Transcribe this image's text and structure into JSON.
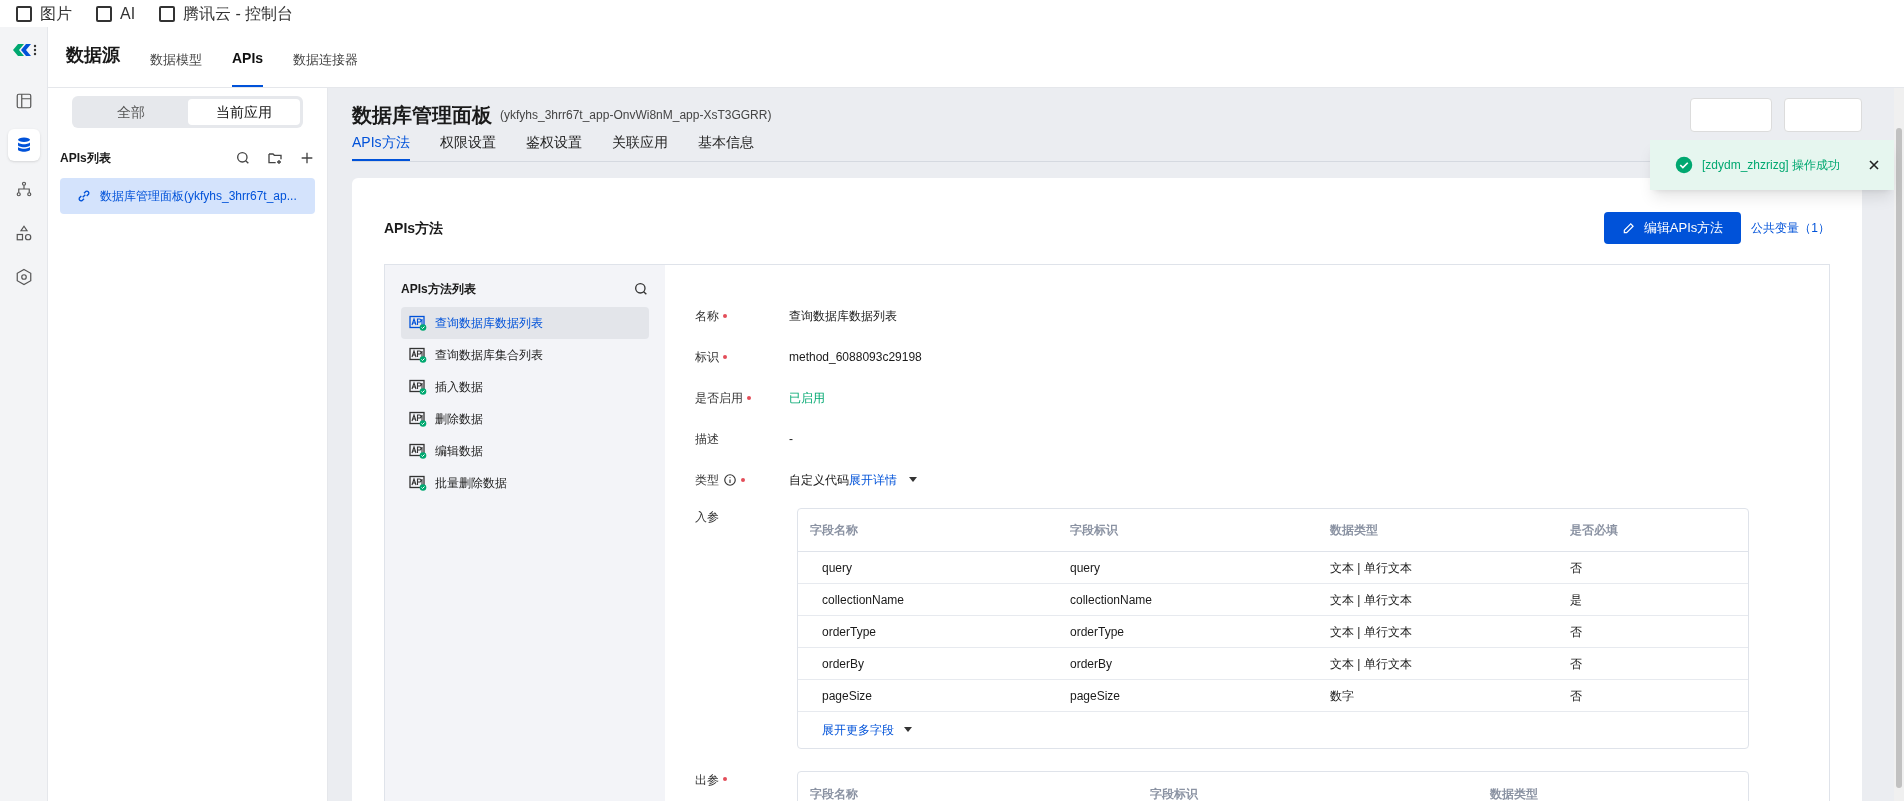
{
  "bookmarks": [
    {
      "label": "图片"
    },
    {
      "label": "AI"
    },
    {
      "label": "腾讯云 - 控制台"
    }
  ],
  "rail": [
    {
      "kind": "layout",
      "selected": false
    },
    {
      "kind": "database",
      "selected": true
    },
    {
      "kind": "tree",
      "selected": false
    },
    {
      "kind": "shapes",
      "selected": false
    },
    {
      "kind": "hexagon",
      "selected": false
    }
  ],
  "header": {
    "title": "数据源",
    "tabs": [
      {
        "label": "数据模型",
        "selected": false
      },
      {
        "label": "APIs",
        "selected": true
      },
      {
        "label": "数据连接器",
        "selected": false
      }
    ]
  },
  "scope_toggle": [
    {
      "label": "全部",
      "selected": false
    },
    {
      "label": "当前应用",
      "selected": true
    }
  ],
  "api_list": {
    "title": "APIs列表",
    "items": [
      {
        "label": "数据库管理面板(ykfyhs_3hrr67t_ap...",
        "selected": true
      }
    ]
  },
  "page": {
    "title": "数据库管理面板",
    "subtitle": "(ykfyhs_3hrr67t_app-OnvWi8nM_app-XsT3GGRR)",
    "tabs": [
      {
        "label": "APIs方法",
        "selected": true
      },
      {
        "label": "权限设置",
        "selected": false
      },
      {
        "label": "鉴权设置",
        "selected": false
      },
      {
        "label": "关联应用",
        "selected": false
      },
      {
        "label": "基本信息",
        "selected": false
      }
    ]
  },
  "toast": {
    "message": "[zdydm_zhzrizg] 操作成功"
  },
  "section": {
    "title": "APIs方法",
    "edit_button": "编辑APIs方法",
    "variables_link": "公共变量（1）"
  },
  "methods": {
    "title": "APIs方法列表",
    "items": [
      {
        "label": "查询数据库数据列表",
        "selected": true
      },
      {
        "label": "查询数据库集合列表",
        "selected": false
      },
      {
        "label": "插入数据",
        "selected": false
      },
      {
        "label": "删除数据",
        "selected": false
      },
      {
        "label": "编辑数据",
        "selected": false
      },
      {
        "label": "批量删除数据",
        "selected": false
      }
    ]
  },
  "details": [
    {
      "kind": "text",
      "label": "名称",
      "required": true,
      "info": false,
      "value": "查询数据库数据列表"
    },
    {
      "kind": "text",
      "label": "标识",
      "required": true,
      "info": false,
      "value": "method_6088093c29198"
    },
    {
      "kind": "status",
      "label": "是否启用",
      "required": true,
      "info": false,
      "value": "已启用"
    },
    {
      "kind": "text",
      "label": "描述",
      "required": false,
      "info": false,
      "value": "-"
    },
    {
      "kind": "expand",
      "label": "类型",
      "required": true,
      "info": true,
      "value": "自定义代码",
      "link": "展开详情"
    }
  ],
  "input_params": {
    "label": "入参",
    "required": false,
    "columns": [
      "字段名称",
      "字段标识",
      "数据类型",
      "是否必填"
    ],
    "rows": [
      [
        "query",
        "query",
        "文本 | 单行文本",
        "否"
      ],
      [
        "collectionName",
        "collectionName",
        "文本 | 单行文本",
        "是"
      ],
      [
        "orderType",
        "orderType",
        "文本 | 单行文本",
        "否"
      ],
      [
        "orderBy",
        "orderBy",
        "文本 | 单行文本",
        "否"
      ],
      [
        "pageSize",
        "pageSize",
        "数字",
        "否"
      ]
    ],
    "more": "展开更多字段"
  },
  "output_params": {
    "label": "出参",
    "required": true,
    "columns": [
      "字段名称",
      "字段标识",
      "数据类型"
    ]
  }
}
